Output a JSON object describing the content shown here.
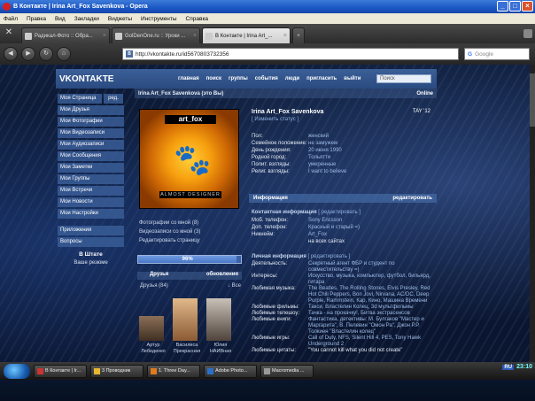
{
  "window": {
    "title": "В Контакте | Irina Art_Fox Savenkova - Opera"
  },
  "menu": [
    "Файл",
    "Правка",
    "Вид",
    "Закладки",
    "Виджеты",
    "Инструменты",
    "Справка"
  ],
  "tabs": [
    {
      "label": "Радикал-Фото :: Обра...",
      "active": false
    },
    {
      "label": "GolDenOne.ru :: Уроки ...",
      "active": false
    },
    {
      "label": "В Контакте | Irina Art_...",
      "active": true
    }
  ],
  "address": {
    "url": "http://vkontakte.ru/id5670803732356",
    "search_placeholder": "Google"
  },
  "vk": {
    "logo": "VKONTAKTE",
    "nav": [
      "главная",
      "поиск",
      "группы",
      "события",
      "люди",
      "пригласить",
      "выйти"
    ],
    "search": "Поиск",
    "sidebar": {
      "first": "Моя Страница",
      "edit": "ред.",
      "items": [
        "Мои Друзья",
        "Мои Фотографии",
        "Мои Видеозаписи",
        "Мои Аудиозаписи",
        "Мои Сообщения",
        "Мои Заметки",
        "Мои Группы",
        "Мои Встречи",
        "Мои Новости",
        "Мои Настройки"
      ],
      "items2": [
        "Приложения",
        "Вопросы"
      ],
      "section": "В Штате",
      "sub": "Ваше резюме"
    },
    "profile_header": {
      "name": "Irina Art_Fox Savenkova (это Вы)",
      "online": "Online"
    },
    "avatar": {
      "title": "art_fox",
      "footer": "ALMOST DESIGNER"
    },
    "links": [
      "Фотографии со мной (8)",
      "Видеозаписи со мной (3)",
      "Редактировать страницу"
    ],
    "progress": {
      "label": "96%",
      "value": 0.96
    },
    "friends": {
      "title": "Друзья",
      "updates": "обновления",
      "count": "Друзья (84)",
      "all": "Все",
      "list": [
        {
          "name": "Артур Лебеденко"
        },
        {
          "name": "Василиса Прекрасная"
        },
        {
          "name": "Юлия НАИВная"
        }
      ]
    },
    "info": {
      "name": "Irina Art_Fox Savenkova",
      "tag": "TAY '12",
      "status_link": "[ Изменить статус ]",
      "basic": [
        {
          "k": "Пол:",
          "v": "женский"
        },
        {
          "k": "Семейное положение:",
          "v": "не замужем"
        },
        {
          "k": "День рождения:",
          "v": "20 июня 1990"
        },
        {
          "k": "Родной город:",
          "v": "Тольятти"
        },
        {
          "k": "Полит. взгляды:",
          "v": "умеренные"
        },
        {
          "k": "Религ. взгляды:",
          "v": "I want to believe"
        }
      ],
      "section_info": "Информация",
      "section_edit": "редактировать",
      "contact_title": "Контактная информация",
      "contact_edit": "[ редактировать ]",
      "contact": [
        {
          "k": "Моб. телефон:",
          "v": "Sony Ericsson"
        },
        {
          "k": "Доп. телефон:",
          "v": "Красный и старый =)"
        },
        {
          "k": "Никнейм:",
          "v": "Art_Fox"
        },
        {
          "k": "",
          "v": "на всех сайтах"
        }
      ],
      "personal_title": "Личная информация",
      "personal_edit": "[ редактировать ]",
      "personal": [
        {
          "k": "Деятельность:",
          "v": "Секретный агент ФБР и студент по совместительству =)"
        },
        {
          "k": "Интересы:",
          "v": "Искусство, музыка, компьютер, футбол, бильярд, гитара"
        },
        {
          "k": "Любимая музыка:",
          "v": "The Beatles, The Rolling Stones, Elvis Presley, Red Hot Chili Peppers, Bon Jovi, Nirvana, AC/DC, Deep Purple, Rammstein, Кар, Кино, Машина Времени"
        },
        {
          "k": "Любимые фильмы:",
          "v": "Такси, Властелин Колец, 3d мультфильмы"
        },
        {
          "k": "Любимые телешоу:",
          "v": "Тачка - на прокачку!, Битва экстрасенсов"
        },
        {
          "k": "Любимые книги:",
          "v": "Фантастика, детективы: М. Булгаков \"Мастер и Маргарита\", В. Пелевин \"Омон Ра\", Джон Р.Р. Толкиен \"Властелин колец\""
        },
        {
          "k": "Любимые игры:",
          "v": "Call of Duty, NFS, Silent Hill 4, PES, Tony Hawk Underground 2"
        },
        {
          "k": "Любимые цитаты:",
          "v": "\"You cannot kill what you did not create\""
        }
      ]
    }
  },
  "taskbar": {
    "tasks": [
      "В Контакте | Ir...",
      "3 Проводник",
      "1. Three Day...",
      "Adobe Photo...",
      "Macromedia ..."
    ],
    "lang": "RU",
    "clock": "23:10"
  }
}
